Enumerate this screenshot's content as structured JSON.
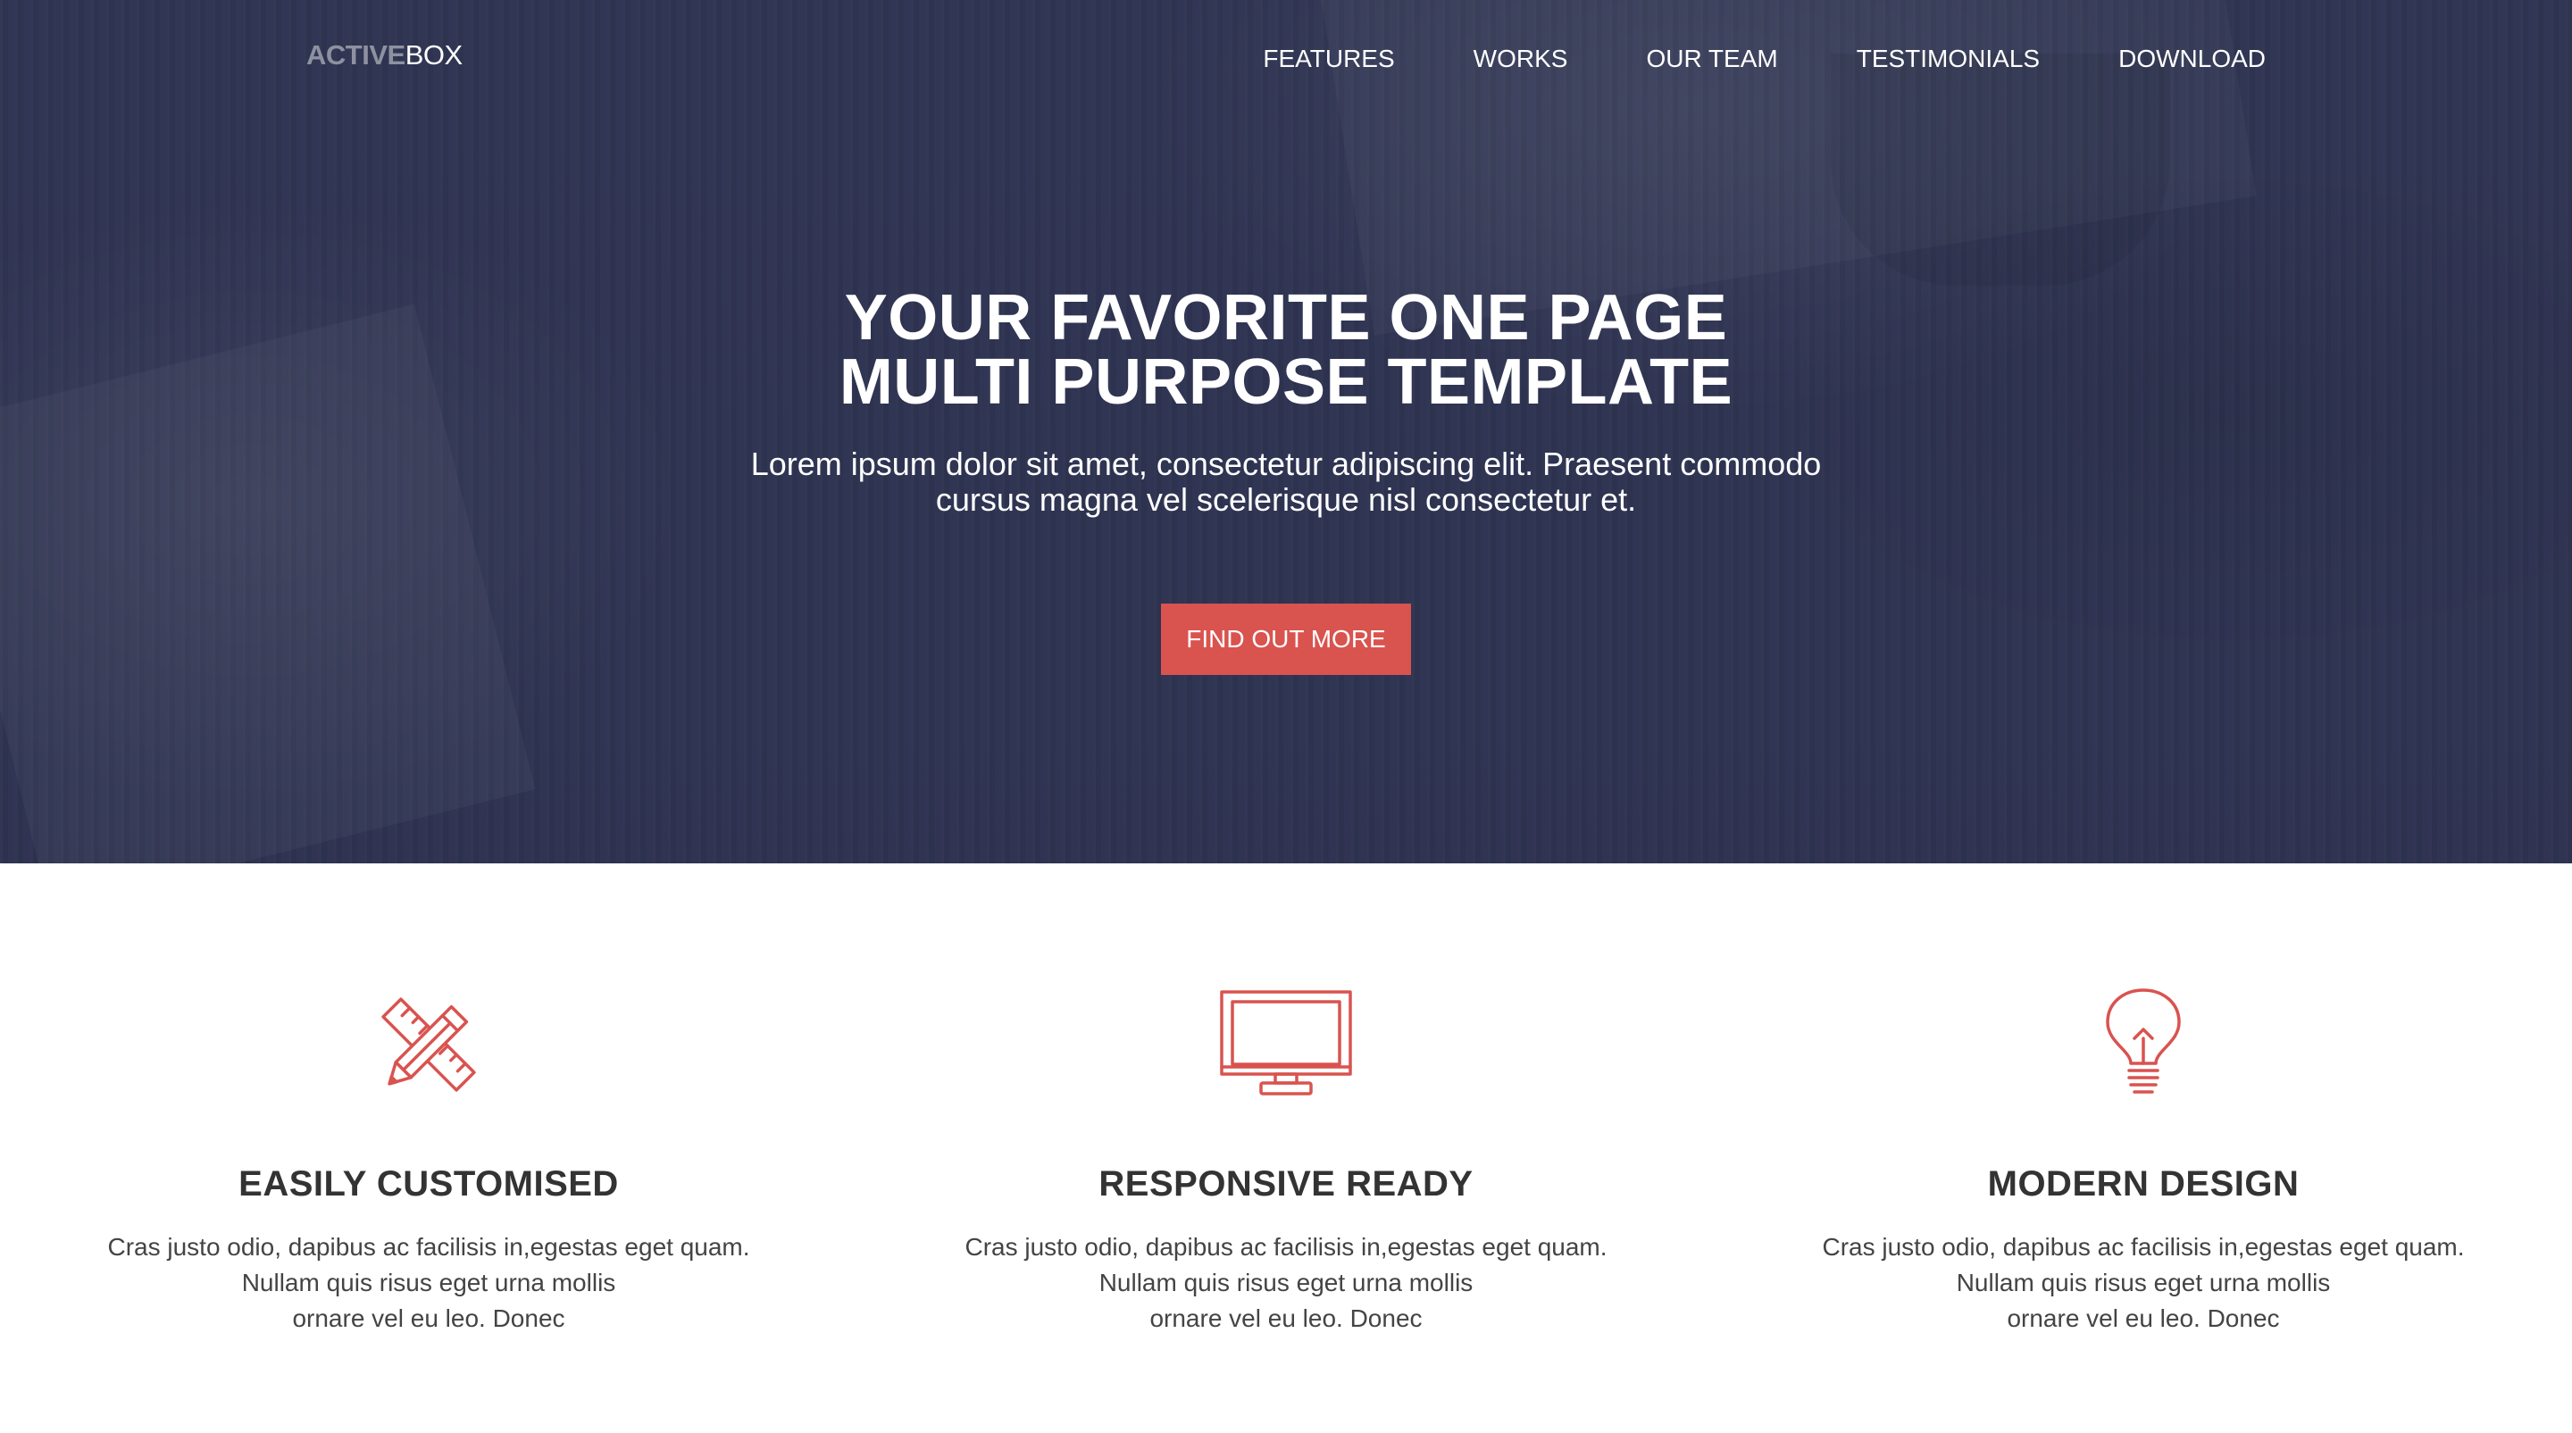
{
  "brand": {
    "logo_part1": "ACTIVE",
    "logo_part2": "BOX"
  },
  "nav": {
    "items": [
      {
        "label": "FEATURES"
      },
      {
        "label": "WORKS"
      },
      {
        "label": "OUR TEAM"
      },
      {
        "label": "TESTIMONIALS"
      },
      {
        "label": "DOWNLOAD"
      }
    ]
  },
  "hero": {
    "title_line1": "YOUR FAVORITE ONE PAGE",
    "title_line2": "MULTI PURPOSE TEMPLATE",
    "subtitle_line1": "Lorem ipsum dolor sit amet, consectetur adipiscing elit. Praesent commodo",
    "subtitle_line2": "cursus magna vel scelerisque nisl consectetur et.",
    "button_label": "FIND OUT MORE"
  },
  "features": [
    {
      "icon": "pencil-ruler-icon",
      "title": "EASILY CUSTOMISED",
      "text_line1": "Cras justo odio, dapibus ac facilisis in,egestas eget quam.",
      "text_line2": "Nullam quis risus eget urna mollis",
      "text_line3": "ornare vel eu leo. Donec"
    },
    {
      "icon": "monitor-icon",
      "title": "RESPONSIVE READY",
      "text_line1": "Cras justo odio, dapibus ac facilisis in,egestas eget quam.",
      "text_line2": "Nullam quis risus eget urna mollis",
      "text_line3": "ornare vel eu leo. Donec"
    },
    {
      "icon": "lightbulb-icon",
      "title": "MODERN DESIGN",
      "text_line1": "Cras justo odio, dapibus ac facilisis in,egestas eget quam.",
      "text_line2": "Nullam quis risus eget urna mollis",
      "text_line3": "ornare vel eu leo. Donec"
    }
  ],
  "colors": {
    "hero_background": "#2f3452",
    "accent": "#d9534f",
    "heading_text": "#333333",
    "body_text": "#444444",
    "logo_muted": "#8e919f"
  }
}
